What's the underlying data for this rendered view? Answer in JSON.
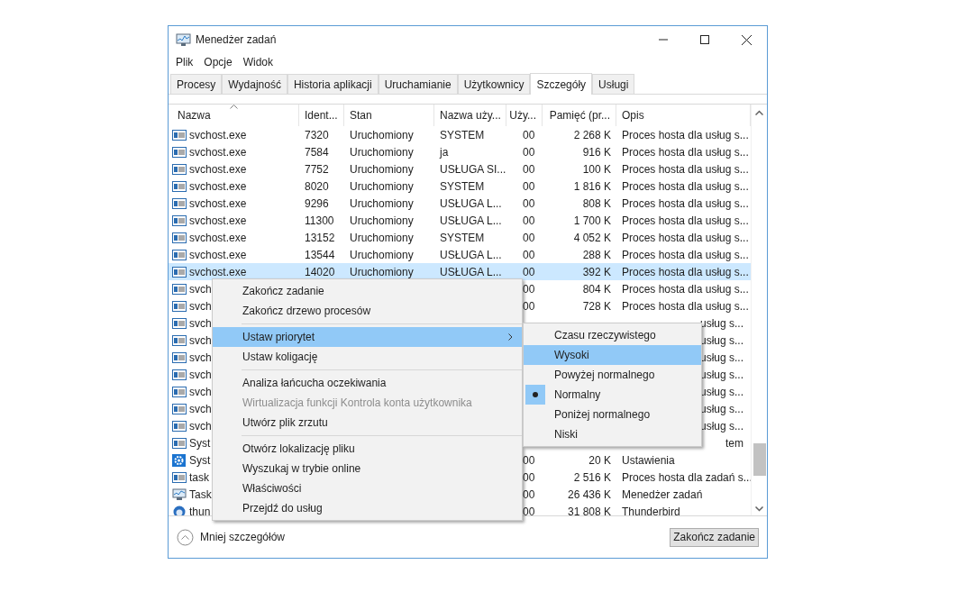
{
  "window": {
    "title": "Menedżer zadań"
  },
  "menu_bar": [
    "Plik",
    "Opcje",
    "Widok"
  ],
  "tabs": [
    {
      "label": "Procesy",
      "selected": false
    },
    {
      "label": "Wydajność",
      "selected": false
    },
    {
      "label": "Historia aplikacji",
      "selected": false
    },
    {
      "label": "Uruchamianie",
      "selected": false
    },
    {
      "label": "Użytkownicy",
      "selected": false
    },
    {
      "label": "Szczegóły",
      "selected": true
    },
    {
      "label": "Usługi",
      "selected": false
    }
  ],
  "table": {
    "columns": [
      "Nazwa",
      "Ident...",
      "Stan",
      "Nazwa uży...",
      "Uży...",
      "Pamięć (pr...",
      "Opis"
    ],
    "rows": [
      {
        "kind": "app",
        "selected": false,
        "cells": [
          "svchost.exe",
          "7320",
          "Uruchomiony",
          "SYSTEM",
          "00",
          "2 268 K",
          "Proces hosta dla usług s..."
        ]
      },
      {
        "kind": "app",
        "selected": false,
        "cells": [
          "svchost.exe",
          "7584",
          "Uruchomiony",
          "ja",
          "00",
          "916 K",
          "Proces hosta dla usług s..."
        ]
      },
      {
        "kind": "app",
        "selected": false,
        "cells": [
          "svchost.exe",
          "7752",
          "Uruchomiony",
          "USŁUGA SI...",
          "00",
          "100 K",
          "Proces hosta dla usług s..."
        ]
      },
      {
        "kind": "app",
        "selected": false,
        "cells": [
          "svchost.exe",
          "8020",
          "Uruchomiony",
          "SYSTEM",
          "00",
          "1 816 K",
          "Proces hosta dla usług s..."
        ]
      },
      {
        "kind": "app",
        "selected": false,
        "cells": [
          "svchost.exe",
          "9296",
          "Uruchomiony",
          "USŁUGA L...",
          "00",
          "808 K",
          "Proces hosta dla usług s..."
        ]
      },
      {
        "kind": "app",
        "selected": false,
        "cells": [
          "svchost.exe",
          "11300",
          "Uruchomiony",
          "USŁUGA L...",
          "00",
          "1 700 K",
          "Proces hosta dla usług s..."
        ]
      },
      {
        "kind": "app",
        "selected": false,
        "cells": [
          "svchost.exe",
          "13152",
          "Uruchomiony",
          "SYSTEM",
          "00",
          "4 052 K",
          "Proces hosta dla usług s..."
        ]
      },
      {
        "kind": "app",
        "selected": false,
        "cells": [
          "svchost.exe",
          "13544",
          "Uruchomiony",
          "USŁUGA L...",
          "00",
          "288 K",
          "Proces hosta dla usług s..."
        ]
      },
      {
        "kind": "app",
        "selected": true,
        "cells": [
          "svchost.exe",
          "14020",
          "Uruchomiony",
          "USŁUGA L...",
          "00",
          "392 K",
          "Proces hosta dla usług s..."
        ]
      },
      {
        "kind": "app",
        "selected": false,
        "cells": [
          "svch",
          "00",
          "804 K",
          "Proces hosta dla usług s..."
        ]
      },
      {
        "kind": "app",
        "selected": false,
        "cells": [
          "svch",
          "00",
          "728 K",
          "Proces hosta dla usług s..."
        ]
      },
      {
        "kind": "app",
        "selected": false,
        "cells": [
          "svch",
          "usług s..."
        ]
      },
      {
        "kind": "app",
        "selected": false,
        "cells": [
          "svch",
          "usług s..."
        ]
      },
      {
        "kind": "app",
        "selected": false,
        "cells": [
          "svch",
          "usług s..."
        ]
      },
      {
        "kind": "app",
        "selected": false,
        "cells": [
          "svch",
          "usług s..."
        ]
      },
      {
        "kind": "app",
        "selected": false,
        "cells": [
          "svch",
          "usług s..."
        ]
      },
      {
        "kind": "app",
        "selected": false,
        "cells": [
          "svch",
          "usług s..."
        ]
      },
      {
        "kind": "app",
        "selected": false,
        "cells": [
          "svch",
          "usług s..."
        ]
      },
      {
        "kind": "app",
        "selected": false,
        "cells": [
          "Syst",
          "tem"
        ]
      },
      {
        "kind": "gear",
        "selected": false,
        "cells": [
          "Syst",
          "00",
          "20 K",
          "Ustawienia"
        ]
      },
      {
        "kind": "app",
        "selected": false,
        "cells": [
          "task",
          "00",
          "2 516 K",
          "Proces hosta dla zadań s..."
        ]
      },
      {
        "kind": "monitor",
        "selected": false,
        "cells": [
          "Task",
          "00",
          "26 436 K",
          "Menedżer zadań"
        ]
      },
      {
        "kind": "globe",
        "selected": false,
        "cells": [
          "thun",
          "00",
          "31 808 K",
          "Thunderbird"
        ]
      }
    ]
  },
  "context_menu": {
    "items": [
      {
        "kind": "item",
        "label": "Zakończ zadanie",
        "selected": false,
        "disabled": false,
        "has_submenu": false
      },
      {
        "kind": "item",
        "label": "Zakończ drzewo procesów",
        "selected": false,
        "disabled": false,
        "has_submenu": false
      },
      {
        "kind": "separator"
      },
      {
        "kind": "item",
        "label": "Ustaw priorytet",
        "selected": true,
        "disabled": false,
        "has_submenu": true
      },
      {
        "kind": "item",
        "label": "Ustaw koligację",
        "selected": false,
        "disabled": false,
        "has_submenu": false
      },
      {
        "kind": "separator"
      },
      {
        "kind": "item",
        "label": "Analiza łańcucha oczekiwania",
        "selected": false,
        "disabled": false,
        "has_submenu": false
      },
      {
        "kind": "item",
        "label": "Wirtualizacja funkcji Kontrola konta użytkownika",
        "selected": false,
        "disabled": true,
        "has_submenu": false
      },
      {
        "kind": "item",
        "label": "Utwórz plik zrzutu",
        "selected": false,
        "disabled": false,
        "has_submenu": false
      },
      {
        "kind": "separator"
      },
      {
        "kind": "item",
        "label": "Otwórz lokalizację pliku",
        "selected": false,
        "disabled": false,
        "has_submenu": false
      },
      {
        "kind": "item",
        "label": "Wyszukaj w trybie online",
        "selected": false,
        "disabled": false,
        "has_submenu": false
      },
      {
        "kind": "item",
        "label": "Właściwości",
        "selected": false,
        "disabled": false,
        "has_submenu": false
      },
      {
        "kind": "item",
        "label": "Przejdź do usług",
        "selected": false,
        "disabled": false,
        "has_submenu": false
      }
    ]
  },
  "submenu": {
    "items": [
      {
        "label": "Czasu rzeczywistego",
        "selected": false,
        "checked": false
      },
      {
        "label": "Wysoki",
        "selected": true,
        "checked": false
      },
      {
        "label": "Powyżej normalnego",
        "selected": false,
        "checked": false
      },
      {
        "label": "Normalny",
        "selected": false,
        "checked": true
      },
      {
        "label": "Poniżej normalnego",
        "selected": false,
        "checked": false
      },
      {
        "label": "Niski",
        "selected": false,
        "checked": false
      }
    ]
  },
  "footer": {
    "toggle": "Mniej szczegółów",
    "button": "Zakończ zadanie"
  }
}
